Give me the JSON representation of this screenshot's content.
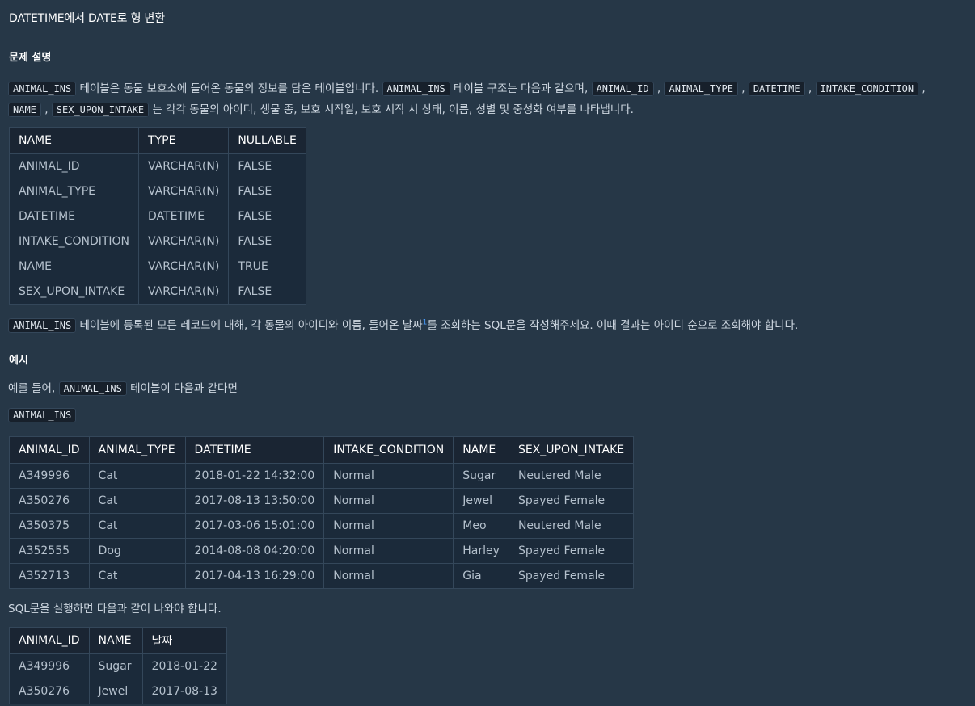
{
  "header": {
    "title": "DATETIME에서 DATE로 형 변환"
  },
  "section_problem": "문제 설명",
  "intro": {
    "code1": "ANIMAL_INS",
    "text1": " 테이블은 동물 보호소에 들어온 동물의 정보를 담은 테이블입니다. ",
    "code2": "ANIMAL_INS",
    "text2": " 테이블 구조는 다음과 같으며, ",
    "code3": "ANIMAL_ID",
    "code4": "ANIMAL_TYPE",
    "code5": "DATETIME",
    "code6": "INTAKE_CONDITION",
    "code7": "NAME",
    "code8": "SEX_UPON_INTAKE",
    "text3": " 는 각각 동물의 아이디, 생물 종, 보호 시작일, 보호 시작 시 상태, 이름, 성별 및 중성화 여부를 나타냅니다."
  },
  "schema_table": {
    "headers": [
      "NAME",
      "TYPE",
      "NULLABLE"
    ],
    "rows": [
      [
        "ANIMAL_ID",
        "VARCHAR(N)",
        "FALSE"
      ],
      [
        "ANIMAL_TYPE",
        "VARCHAR(N)",
        "FALSE"
      ],
      [
        "DATETIME",
        "DATETIME",
        "FALSE"
      ],
      [
        "INTAKE_CONDITION",
        "VARCHAR(N)",
        "FALSE"
      ],
      [
        "NAME",
        "VARCHAR(N)",
        "TRUE"
      ],
      [
        "SEX_UPON_INTAKE",
        "VARCHAR(N)",
        "FALSE"
      ]
    ]
  },
  "task": {
    "code": "ANIMAL_INS",
    "text1": " 테이블에 등록된 모든 레코드에 대해, 각 동물의 아이디와 이름, 들어온 날짜",
    "footnote": "1",
    "text2": "를 조회하는 SQL문을 작성해주세요. 이때 결과는 아이디 순으로 조회해야 합니다."
  },
  "section_example": "예시",
  "example_intro": {
    "text1": "예를 들어, ",
    "code": "ANIMAL_INS",
    "text2": " 테이블이 다음과 같다면"
  },
  "example_table_label": "ANIMAL_INS",
  "example_table": {
    "headers": [
      "ANIMAL_ID",
      "ANIMAL_TYPE",
      "DATETIME",
      "INTAKE_CONDITION",
      "NAME",
      "SEX_UPON_INTAKE"
    ],
    "rows": [
      [
        "A349996",
        "Cat",
        "2018-01-22 14:32:00",
        "Normal",
        "Sugar",
        "Neutered Male"
      ],
      [
        "A350276",
        "Cat",
        "2017-08-13 13:50:00",
        "Normal",
        "Jewel",
        "Spayed Female"
      ],
      [
        "A350375",
        "Cat",
        "2017-03-06 15:01:00",
        "Normal",
        "Meo",
        "Neutered Male"
      ],
      [
        "A352555",
        "Dog",
        "2014-08-08 04:20:00",
        "Normal",
        "Harley",
        "Spayed Female"
      ],
      [
        "A352713",
        "Cat",
        "2017-04-13 16:29:00",
        "Normal",
        "Gia",
        "Spayed Female"
      ]
    ]
  },
  "result_intro": "SQL문을 실행하면 다음과 같이 나와야 합니다.",
  "result_table": {
    "headers": [
      "ANIMAL_ID",
      "NAME",
      "날짜"
    ],
    "rows": [
      [
        "A349996",
        "Sugar",
        "2018-01-22"
      ],
      [
        "A350276",
        "Jewel",
        "2017-08-13"
      ]
    ]
  }
}
